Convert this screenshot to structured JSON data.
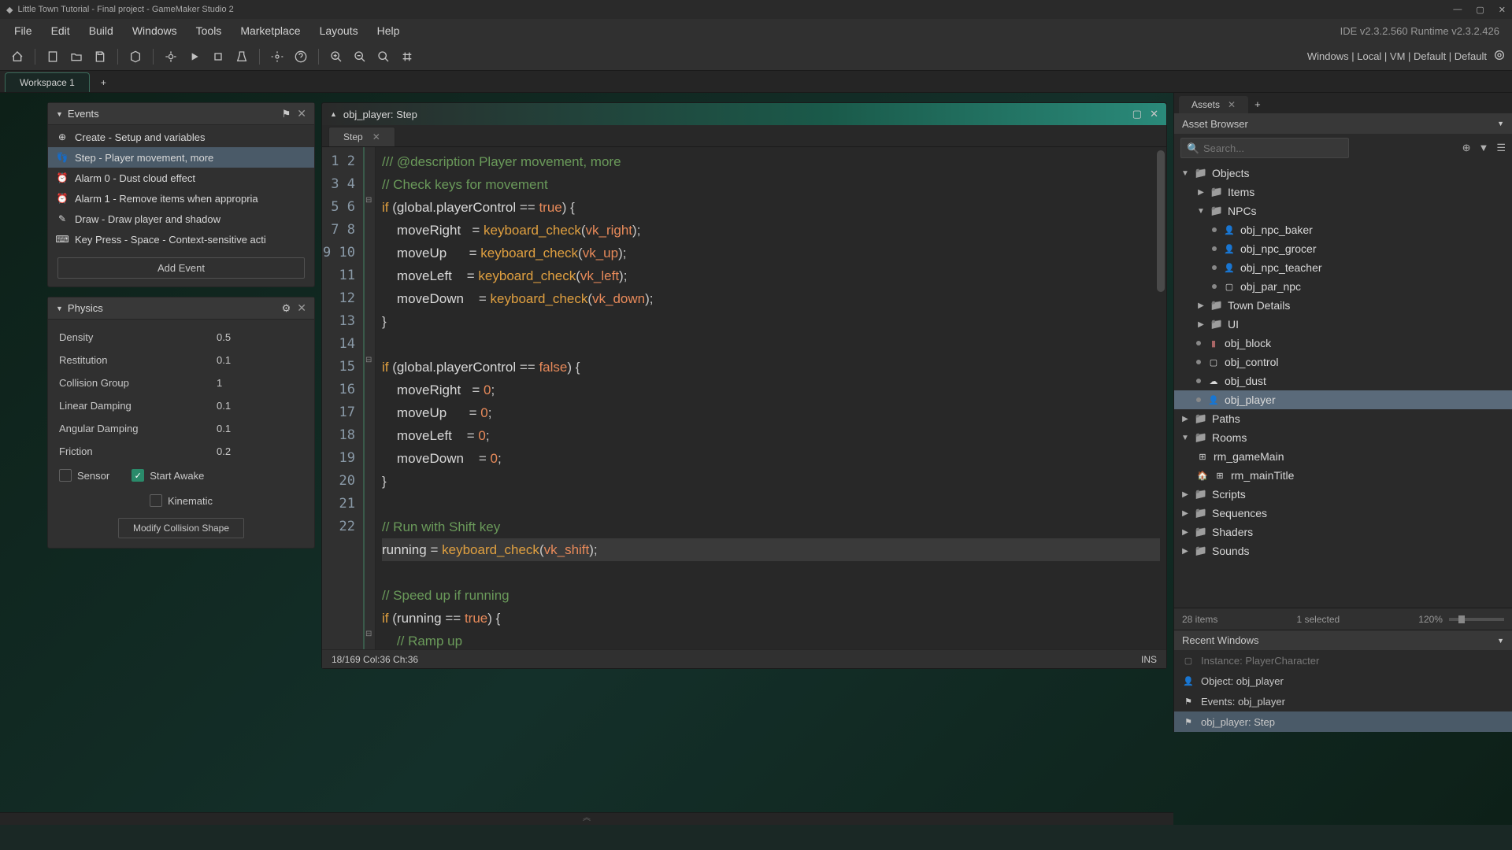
{
  "titlebar": {
    "title": "Little Town Tutorial - Final project - GameMaker Studio 2"
  },
  "menubar": {
    "items": [
      "File",
      "Edit",
      "Build",
      "Windows",
      "Tools",
      "Marketplace",
      "Layouts",
      "Help"
    ],
    "version": "IDE v2.3.2.560   Runtime v2.3.2.426"
  },
  "toolbar_right": {
    "config": "Windows | Local | VM | Default | Default"
  },
  "workspace": {
    "tab": "Workspace 1"
  },
  "events_panel": {
    "title": "Events",
    "items": [
      "Create - Setup and variables",
      "Step - Player movement, more",
      "Alarm 0 - Dust cloud effect",
      "Alarm 1 - Remove items when appropria",
      "Draw - Draw player and shadow",
      "Key Press - Space - Context-sensitive acti"
    ],
    "add_btn": "Add Event"
  },
  "physics_panel": {
    "title": "Physics",
    "props": [
      {
        "label": "Density",
        "value": "0.5"
      },
      {
        "label": "Restitution",
        "value": "0.1"
      },
      {
        "label": "Collision Group",
        "value": "1"
      },
      {
        "label": "Linear Damping",
        "value": "0.1"
      },
      {
        "label": "Angular Damping",
        "value": "0.1"
      },
      {
        "label": "Friction",
        "value": "0.2"
      }
    ],
    "sensor": "Sensor",
    "start_awake": "Start Awake",
    "kinematic": "Kinematic",
    "modify_btn": "Modify Collision Shape"
  },
  "code": {
    "header": "obj_player: Step",
    "tab": "Step",
    "status_pos": "18/169 Col:36 Ch:36",
    "status_mode": "INS"
  },
  "assets": {
    "tab": "Assets",
    "header": "Asset Browser",
    "search_placeholder": "Search...",
    "footer_count": "28 items",
    "footer_selected": "1 selected",
    "footer_zoom": "120%"
  },
  "tree": {
    "objects": "Objects",
    "items": "Items",
    "npcs": "NPCs",
    "npc_baker": "obj_npc_baker",
    "npc_grocer": "obj_npc_grocer",
    "npc_teacher": "obj_npc_teacher",
    "par_npc": "obj_par_npc",
    "town_details": "Town Details",
    "ui": "UI",
    "obj_block": "obj_block",
    "obj_control": "obj_control",
    "obj_dust": "obj_dust",
    "obj_player": "obj_player",
    "paths": "Paths",
    "rooms": "Rooms",
    "rm_gamemain": "rm_gameMain",
    "rm_maintitle": "rm_mainTitle",
    "scripts": "Scripts",
    "sequences": "Sequences",
    "shaders": "Shaders",
    "sounds": "Sounds"
  },
  "recent": {
    "header": "Recent Windows",
    "items": [
      "Instance: PlayerCharacter",
      "Object: obj_player",
      "Events: obj_player",
      "obj_player: Step"
    ]
  },
  "chart_data": null
}
